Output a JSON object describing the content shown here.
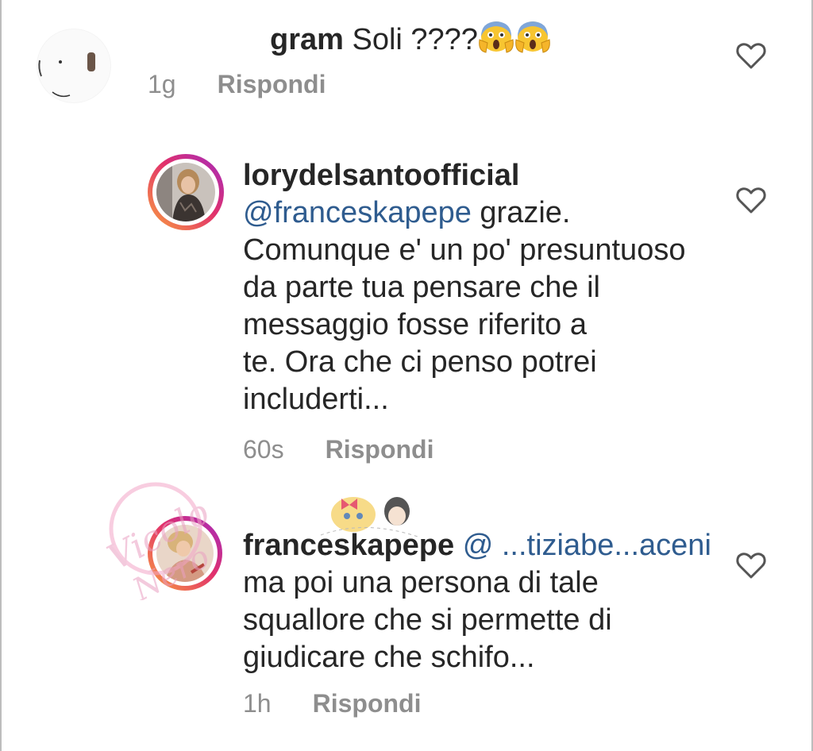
{
  "comments": [
    {
      "username": "gram",
      "text": "Soli ????",
      "emojis": [
        "face-screaming-in-fear-emoji",
        "face-screaming-in-fear-emoji"
      ],
      "time": "1g",
      "reply_label": "Rispondi"
    },
    {
      "username": "lorydelsantoofficial",
      "mention": "@franceskapepe",
      "first_line_rest": "grazie.",
      "lines": [
        "Comunque e' un po' presuntuoso",
        "da parte tua pensare che il",
        "messaggio fosse riferito a",
        "te. Ora che ci penso potrei",
        "includerti..."
      ],
      "time": "60s",
      "reply_label": "Rispondi"
    },
    {
      "username": "franceskapepe",
      "mention": "@ ...tiziabe...aceni",
      "lines": [
        "ma poi una persona di tale",
        "squallore che si permette di",
        "giudicare che schifo..."
      ],
      "time": "1h",
      "reply_label": "Rispondi"
    }
  ],
  "icons": {
    "like": "heart-outline-icon"
  },
  "colors": {
    "mention": "#2f5c8f",
    "meta": "#8e8e8e",
    "ring_start": "#f9a03f",
    "ring_end": "#a12bc1"
  },
  "watermark": {
    "text": "Vicolo Nero"
  }
}
